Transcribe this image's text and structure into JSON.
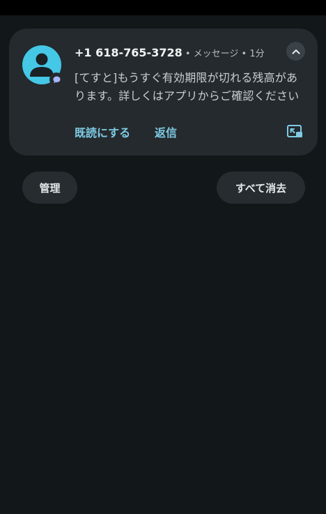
{
  "notification": {
    "sender": "+1 618-765-3728",
    "separator": " • ",
    "app_name": "メッセージ",
    "time": "1分",
    "body": "[てすと]もうすぐ有効期限が切れる残高があります。詳しくはアプリからご確認ください",
    "actions": {
      "mark_read": "既読にする",
      "reply": "返信"
    },
    "icons": {
      "avatar": "person-icon",
      "badge": "message-badge-icon",
      "collapse": "chevron-up-icon",
      "expand": "picture-in-picture-icon"
    }
  },
  "footer": {
    "manage_label": "管理",
    "clear_all_label": "すべて消去"
  },
  "colors": {
    "background": "#12171a",
    "card": "#242a2e",
    "avatar": "#45c7e6",
    "accent": "#7fcbe4",
    "badge": "#a9b7ff"
  }
}
